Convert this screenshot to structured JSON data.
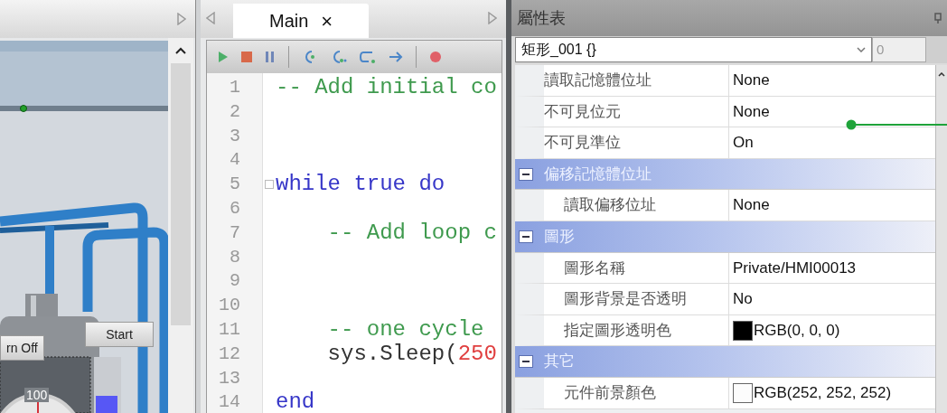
{
  "hmi_panel": {
    "buttons": [
      {
        "label": "rn Off"
      },
      {
        "label": "Start"
      }
    ],
    "gauge_label": "100"
  },
  "editor": {
    "tabs": [
      {
        "label": "Main",
        "selected": true,
        "close": "×"
      }
    ],
    "lines": [
      {
        "number": "1",
        "segments": [
          {
            "kind": "comment",
            "text": "-- Add initial co"
          }
        ]
      },
      {
        "number": "2"
      },
      {
        "number": "3"
      },
      {
        "number": "4"
      },
      {
        "number": "5",
        "fold": true,
        "segments": [
          {
            "kind": "keyword",
            "text": "while true do"
          }
        ]
      },
      {
        "number": "6"
      },
      {
        "number": "7",
        "segments": [
          {
            "kind": "comment",
            "text": "    -- Add loop c"
          }
        ]
      },
      {
        "number": "8"
      },
      {
        "number": "9"
      },
      {
        "number": "10"
      },
      {
        "number": "11",
        "segments": [
          {
            "kind": "comment",
            "text": "    -- one cycle"
          }
        ]
      },
      {
        "number": "12",
        "segments": [
          {
            "kind": "plain",
            "text": "    sys.Sleep("
          },
          {
            "kind": "number",
            "text": "250"
          }
        ]
      },
      {
        "number": "13"
      },
      {
        "number": "14",
        "segments": [
          {
            "kind": "keyword",
            "text": "end"
          }
        ]
      }
    ]
  },
  "properties": {
    "title": "屬性表",
    "object_selector": {
      "value": "矩形_001 {}",
      "index_value": "0"
    },
    "rows": [
      {
        "kind": "property",
        "name": "讀取記憶體位址",
        "value": "None"
      },
      {
        "kind": "property",
        "name": "不可見位元",
        "value": "None"
      },
      {
        "kind": "property",
        "name": "不可見準位",
        "value": "On"
      },
      {
        "kind": "group",
        "name": "偏移記憶體位址",
        "expanded": true,
        "children": [
          {
            "kind": "property",
            "name": "讀取偏移位址",
            "value": "None"
          }
        ]
      },
      {
        "kind": "group",
        "name": "圖形",
        "expanded": true,
        "children": [
          {
            "kind": "property",
            "name": "圖形名稱",
            "value": "Private/HMI00013"
          },
          {
            "kind": "property",
            "name": "圖形背景是否透明",
            "value": "No"
          },
          {
            "kind": "property",
            "name": "指定圖形透明色",
            "value": "RGB(0, 0, 0)",
            "color": "#000000"
          }
        ]
      },
      {
        "kind": "group",
        "name": "其它",
        "expanded": true,
        "children": [
          {
            "kind": "property",
            "name": "元件前景顏色",
            "value": "RGB(252, 252, 252)",
            "color": "#fcfcfc"
          }
        ]
      }
    ]
  }
}
